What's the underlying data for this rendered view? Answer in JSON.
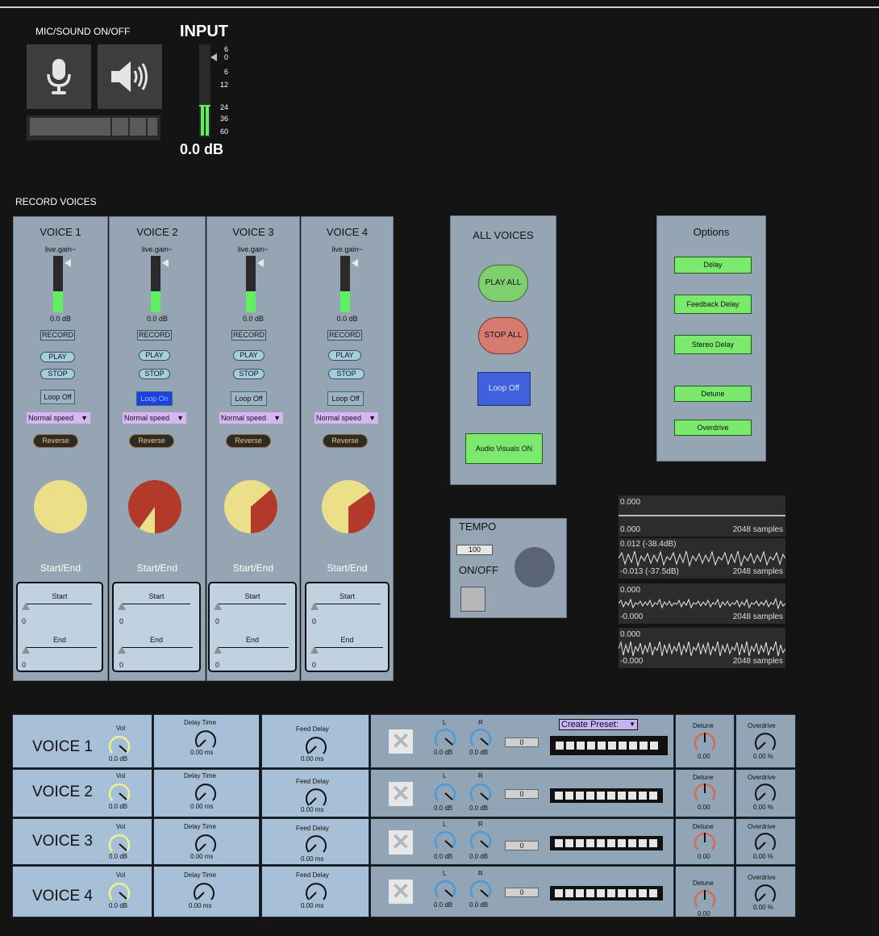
{
  "header": {
    "mic_sound": "MIC/SOUND ON/OFF",
    "input": "INPUT",
    "input_db": "0.0 dB",
    "scale": [
      "6",
      "0",
      "6",
      "12",
      "24",
      "36",
      "60"
    ]
  },
  "record_voices": "RECORD VOICES",
  "voices": [
    {
      "title": "VOICE 1",
      "gain": "live.gain~",
      "db": "0.0 dB",
      "record": "RECORD",
      "play": "PLAY",
      "stop": "STOP",
      "loop": "Loop Off",
      "speed": "Normal speed",
      "reverse": "Reverse",
      "startend": "Start/End",
      "start": "Start",
      "end": "End",
      "start_val": "0",
      "end_val": "0"
    },
    {
      "title": "VOICE 2",
      "gain": "live.gain~",
      "db": "0.0 dB",
      "record": "RECORD",
      "play": "PLAY",
      "stop": "STOP",
      "loop": "Loop On",
      "speed": "Normal speed",
      "reverse": "Reverse",
      "startend": "Start/End",
      "start": "Start",
      "end": "End",
      "start_val": "0",
      "end_val": "0"
    },
    {
      "title": "VOICE 3",
      "gain": "live.gain~",
      "db": "0.0 dB",
      "record": "RECORD",
      "play": "PLAY",
      "stop": "STOP",
      "loop": "Loop Off",
      "speed": "Normal speed",
      "reverse": "Reverse",
      "startend": "Start/End",
      "start": "Start",
      "end": "End",
      "start_val": "0",
      "end_val": "0"
    },
    {
      "title": "VOICE 4",
      "gain": "live.gain~",
      "db": "0.0 dB",
      "record": "RECORD",
      "play": "PLAY",
      "stop": "STOP",
      "loop": "Loop Off",
      "speed": "Normal speed",
      "reverse": "Reverse",
      "startend": "Start/End",
      "start": "Start",
      "end": "End",
      "start_val": "0",
      "end_val": "0"
    }
  ],
  "all_voices": {
    "title": "ALL VOICES",
    "play_all": "PLAY ALL",
    "stop_all": "STOP ALL",
    "loop": "Loop Off",
    "audio_visuals": "Audio Visuals ON"
  },
  "options": {
    "title": "Options",
    "buttons": [
      "Delay",
      "Feedback Delay",
      "Stereo Delay",
      "Detune",
      "Overdrive"
    ]
  },
  "tempo": {
    "title": "TEMPO",
    "value": "100",
    "onoff": "ON/OFF"
  },
  "scopes": [
    {
      "top": "0.000",
      "bottom": "0.000",
      "samples": "2048 samples"
    },
    {
      "top": "0.012 (-38.4dB)",
      "bottom": "-0.013 (-37.5dB)",
      "samples": "2048 samples"
    },
    {
      "top": "0.000",
      "bottom": "-0.000",
      "samples": "2048 samples"
    },
    {
      "top": "0.000",
      "bottom": "-0.000",
      "samples": "2048 samples"
    }
  ],
  "mixer": {
    "rows": [
      {
        "name": "VOICE 1",
        "vol": "Vol",
        "vol_val": "0.0 dB",
        "delay_time": "Delay Time",
        "delay_val": "0.00 ms",
        "feed_delay": "Feed Delay",
        "feed_val": "0.00 ms",
        "l": "L",
        "r": "R",
        "l_val": "0.0 dB",
        "r_val": "0.0 dB",
        "num": "0",
        "detune": "Detune",
        "detune_val": "0.00",
        "overdrive": "Overdrive",
        "overdrive_val": "0.00 %"
      },
      {
        "name": "VOICE 2",
        "vol": "Vol",
        "vol_val": "0.0 dB",
        "delay_time": "Delay Time",
        "delay_val": "0.00 ms",
        "feed_delay": "Feed Delay",
        "feed_val": "0.00 ms",
        "l": "L",
        "r": "R",
        "l_val": "0.0 dB",
        "r_val": "0.0 dB",
        "num": "0",
        "detune": "Detune",
        "detune_val": "0.00",
        "overdrive": "Overdrive",
        "overdrive_val": "0.00 %"
      },
      {
        "name": "VOICE 3",
        "vol": "Vol",
        "vol_val": "0.0 dB",
        "delay_time": "Delay Time",
        "delay_val": "0.00 ms",
        "feed_delay": "Feed Delay",
        "feed_val": "0.00 ms",
        "l": "L",
        "r": "R",
        "l_val": "0.0 dB",
        "r_val": "0.0 dB",
        "num": "0",
        "detune": "Detune",
        "detune_val": "0.00",
        "overdrive": "Overdrive",
        "overdrive_val": "0.00 %"
      },
      {
        "name": "VOICE 4",
        "vol": "Vol",
        "vol_val": "0.0 dB",
        "delay_time": "Delay Time",
        "delay_val": "0.00 ms",
        "feed_delay": "Feed Delay",
        "feed_val": "0.00 ms",
        "l": "L",
        "r": "R",
        "l_val": "0.0 dB",
        "r_val": "0.0 dB",
        "num": "0",
        "detune": "Detune",
        "detune_val": "0.00",
        "overdrive": "Overdrive",
        "overdrive_val": "0.00 %"
      }
    ],
    "preset": "Create Preset:"
  },
  "colors": {
    "panel": "#96a5b3",
    "green": "#7be96b",
    "meter": "#5ef05e",
    "pie_light": "#ecdf8a",
    "pie_red": "#b33a2a"
  }
}
